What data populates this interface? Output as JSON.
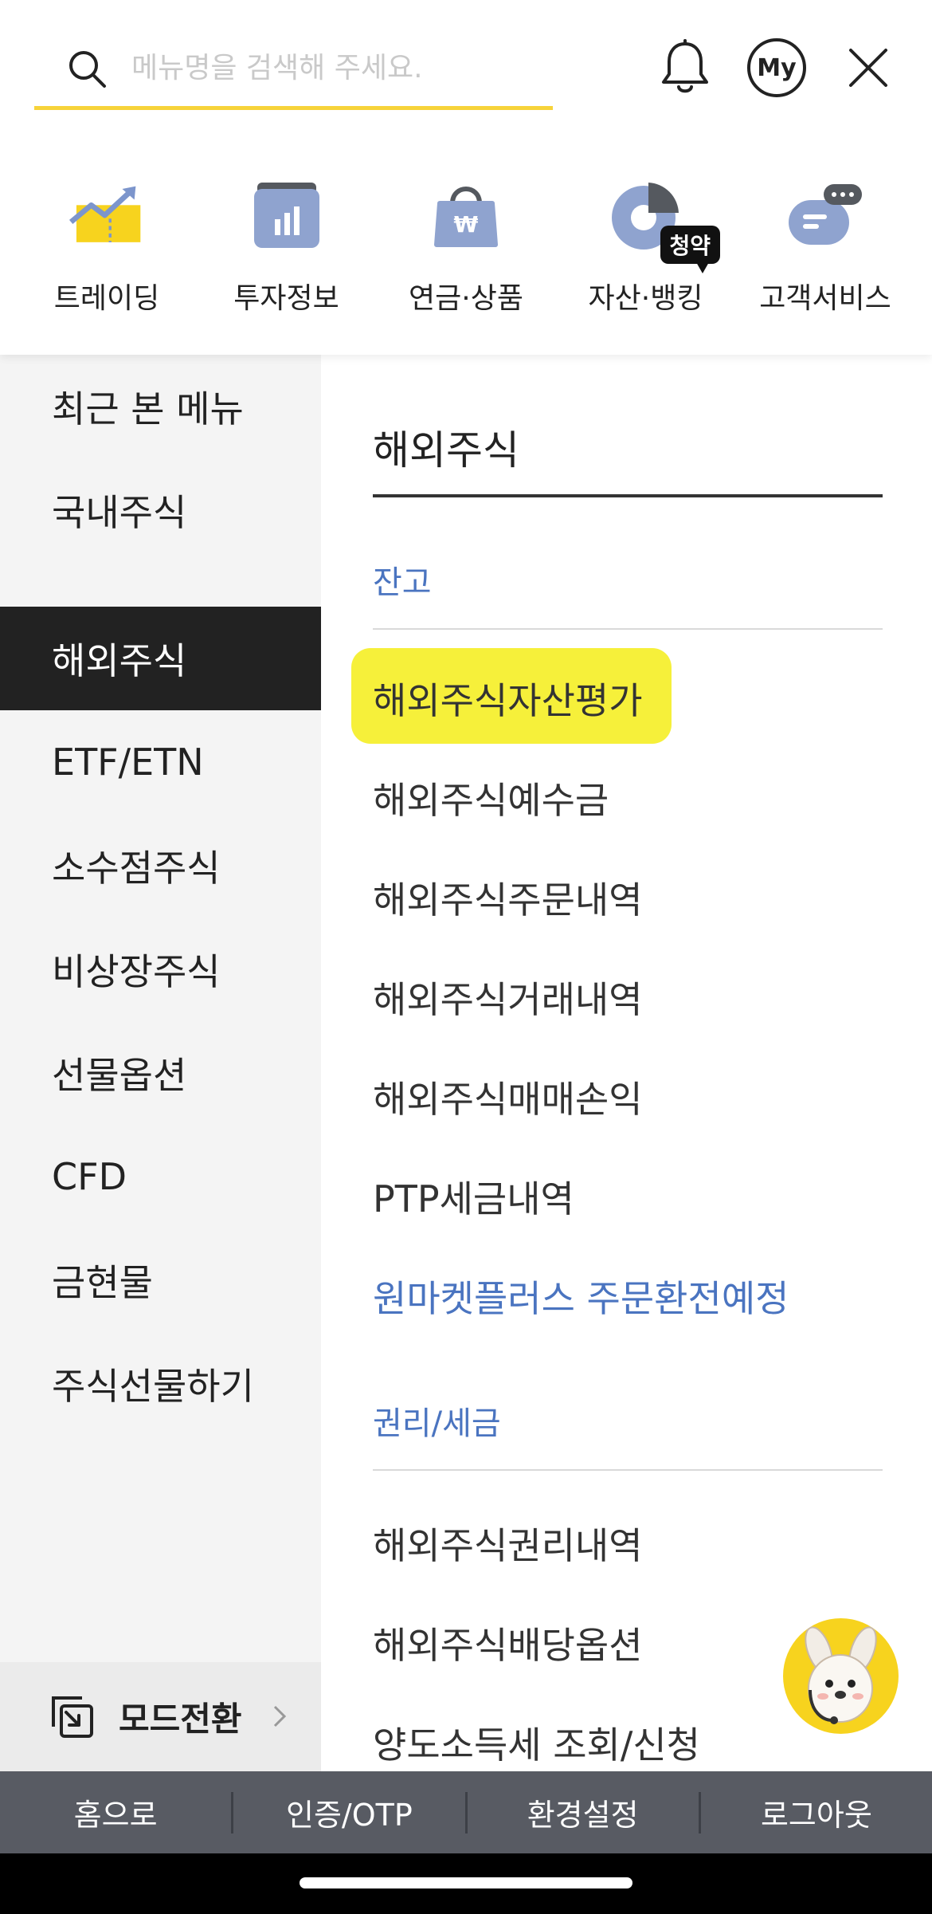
{
  "search": {
    "placeholder": "메뉴명을 검색해 주세요."
  },
  "header_icons": {
    "my_label": "My"
  },
  "quick_menu": [
    {
      "label": "트레이딩",
      "icon": "trading-chart-icon"
    },
    {
      "label": "투자정보",
      "icon": "info-folder-icon"
    },
    {
      "label": "연금·상품",
      "icon": "won-bag-icon"
    },
    {
      "label": "자산·뱅킹",
      "icon": "pie-chart-icon",
      "badge": "청약"
    },
    {
      "label": "고객서비스",
      "icon": "chat-bubble-icon"
    }
  ],
  "left_nav": {
    "items": [
      {
        "label": "최근 본 메뉴"
      },
      {
        "label": "국내주식"
      },
      {
        "label": "해외주식",
        "active": true
      },
      {
        "label": "ETF/ETN"
      },
      {
        "label": "소수점주식"
      },
      {
        "label": "비상장주식"
      },
      {
        "label": "선물옵션"
      },
      {
        "label": "CFD"
      },
      {
        "label": "금현물"
      },
      {
        "label": "주식선물하기"
      }
    ],
    "mode_switch": "모드전환"
  },
  "panel": {
    "title": "해외주식",
    "sections": [
      {
        "title": "잔고",
        "links": [
          {
            "label": "해외주식자산평가",
            "highlighted": true
          },
          {
            "label": "해외주식예수금"
          },
          {
            "label": "해외주식주문내역"
          },
          {
            "label": "해외주식거래내역"
          },
          {
            "label": "해외주식매매손익"
          },
          {
            "label": "PTP세금내역"
          },
          {
            "label": "원마켓플러스 주문환전예정",
            "blue": true
          }
        ]
      },
      {
        "title": "권리/세금",
        "links": [
          {
            "label": "해외주식권리내역"
          },
          {
            "label": "해외주식배당옵션"
          },
          {
            "label": "양도소득세 조회/신청"
          }
        ]
      }
    ]
  },
  "footer": [
    "홈으로",
    "인증/OTP",
    "환경설정",
    "로그아웃"
  ],
  "colors": {
    "accent_yellow": "#f7d33a",
    "link_blue": "#4a74c0",
    "active_nav": "#222222",
    "footer_bg": "#585b63"
  }
}
